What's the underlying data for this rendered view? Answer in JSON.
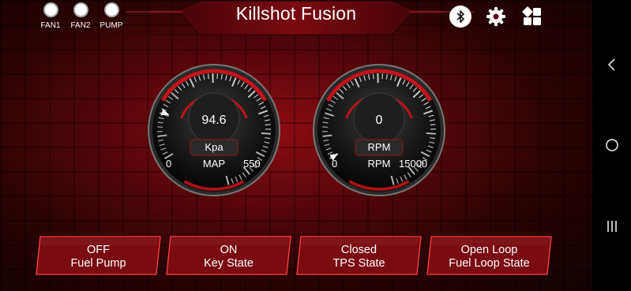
{
  "app": {
    "title": "Killshot Fusion"
  },
  "indicators": [
    {
      "label": "FAN1"
    },
    {
      "label": "FAN2"
    },
    {
      "label": "PUMP"
    }
  ],
  "toolbar": {
    "bluetooth_icon": "bluetooth-icon",
    "settings_icon": "gear-icon",
    "dashboard_icon": "dashboard-grid-icon"
  },
  "gauges": [
    {
      "value": "94.6",
      "unit": "Kpa",
      "name": "MAP",
      "min": "0",
      "max": "550",
      "fraction": 0.172
    },
    {
      "value": "0",
      "unit": "RPM",
      "name": "RPM",
      "min": "0",
      "max": "15000",
      "fraction": 0.0
    }
  ],
  "cards": [
    {
      "value": "OFF",
      "label": "Fuel Pump"
    },
    {
      "value": "ON",
      "label": "Key State"
    },
    {
      "value": "Closed",
      "label": "TPS State"
    },
    {
      "value": "Open Loop",
      "label": "Fuel Loop State"
    }
  ],
  "system_nav": {
    "back_icon": "back-chevron-icon",
    "home_icon": "home-circle-icon",
    "recents_icon": "recents-icon"
  },
  "colors": {
    "accent": "#c8101a",
    "panel": "#6d0a0e",
    "border": "#ff3a3a"
  }
}
